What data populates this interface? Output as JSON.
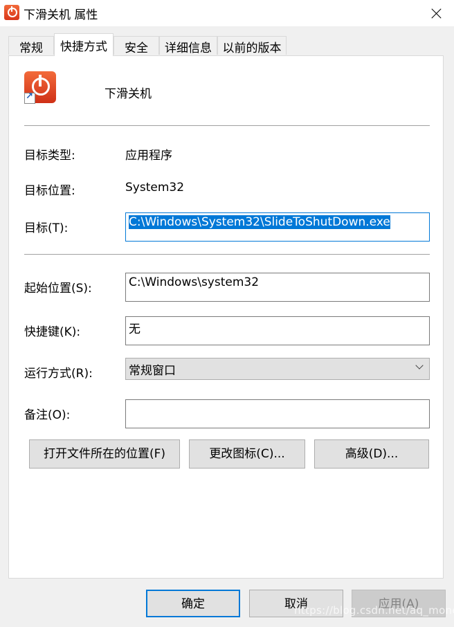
{
  "window": {
    "title": "下滑关机 属性"
  },
  "tabs": [
    {
      "label": "常规"
    },
    {
      "label": "快捷方式"
    },
    {
      "label": "安全"
    },
    {
      "label": "详细信息"
    },
    {
      "label": "以前的版本"
    }
  ],
  "shortcut": {
    "name": "下滑关机"
  },
  "fields": {
    "target_type_label": "目标类型:",
    "target_type_value": "应用程序",
    "target_location_label": "目标位置:",
    "target_location_value": "System32",
    "target_label": "目标(T):",
    "target_value": "C:\\Windows\\System32\\SlideToShutDown.exe",
    "start_in_label": "起始位置(S):",
    "start_in_value": "C:\\Windows\\system32",
    "shortcut_key_label": "快捷键(K):",
    "shortcut_key_value": "无",
    "run_label": "运行方式(R):",
    "run_value": "常规窗口",
    "comment_label": "备注(O):",
    "comment_value": ""
  },
  "buttons": {
    "open_location": "打开文件所在的位置(F)",
    "change_icon": "更改图标(C)...",
    "advanced": "高级(D)..."
  },
  "footer": {
    "ok": "确定",
    "cancel": "取消",
    "apply": "应用(A)"
  },
  "watermark": "https://blog.csdn.net/aq_money",
  "icons": {
    "app": "power-icon",
    "close": "close-icon",
    "shortcut": "shortcut-arrow-icon",
    "dropdown": "chevron-down-icon"
  },
  "colors": {
    "accent": "#0078d7",
    "app_icon": "#e0442a"
  }
}
